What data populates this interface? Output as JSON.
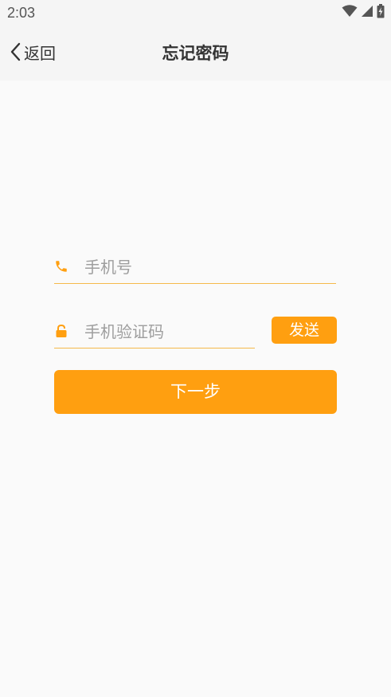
{
  "status_bar": {
    "time": "2:03",
    "icons": [
      "wifi-icon",
      "signal-icon",
      "battery-charging-icon"
    ]
  },
  "header": {
    "back_label": "返回",
    "title": "忘记密码"
  },
  "form": {
    "phone": {
      "icon": "phone-icon",
      "placeholder": "手机号",
      "value": ""
    },
    "code": {
      "icon": "lock-icon",
      "placeholder": "手机验证码",
      "value": ""
    },
    "send_label": "发送",
    "next_label": "下一步"
  },
  "colors": {
    "accent": "#ff9f10",
    "underline": "#f5b94a",
    "background": "#fafafa",
    "header_bg": "#f5f5f5"
  }
}
